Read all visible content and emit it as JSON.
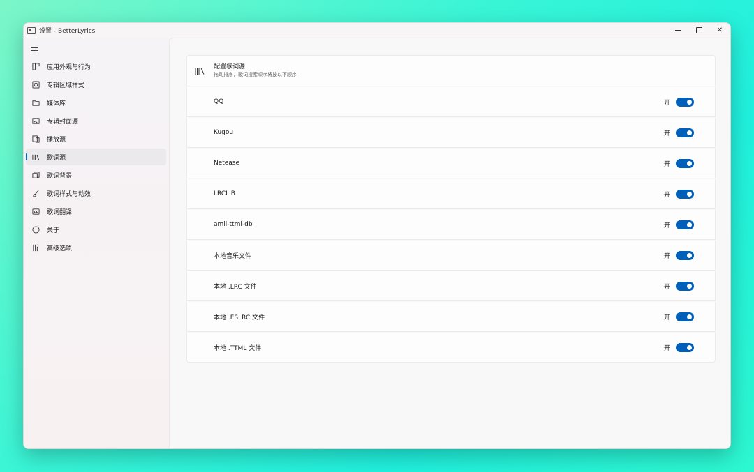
{
  "window": {
    "title": "设置 - BetterLyrics",
    "controls": {
      "minimize": "minimize",
      "maximize": "maximize",
      "close": "✕"
    }
  },
  "sidebar": {
    "items": [
      {
        "label": "应用外观与行为",
        "icon": "layout-icon"
      },
      {
        "label": "专辑区域样式",
        "icon": "album-frame-icon"
      },
      {
        "label": "媒体库",
        "icon": "folder-icon"
      },
      {
        "label": "专辑封面源",
        "icon": "cover-icon"
      },
      {
        "label": "播放源",
        "icon": "player-icon"
      },
      {
        "label": "歌词源",
        "icon": "library-icon",
        "active": true
      },
      {
        "label": "歌词背景",
        "icon": "background-icon"
      },
      {
        "label": "歌词样式与动效",
        "icon": "brush-icon"
      },
      {
        "label": "歌词翻译",
        "icon": "cc-icon"
      },
      {
        "label": "关于",
        "icon": "info-icon"
      },
      {
        "label": "高级选项",
        "icon": "tools-icon"
      }
    ]
  },
  "main": {
    "header": {
      "title": "配置歌词源",
      "subtitle": "拖动排序，歌词搜索顺序将按以下顺序"
    },
    "sources": [
      {
        "name": "QQ",
        "state_label": "开",
        "enabled": true
      },
      {
        "name": "Kugou",
        "state_label": "开",
        "enabled": true
      },
      {
        "name": "Netease",
        "state_label": "开",
        "enabled": true
      },
      {
        "name": "LRCLIB",
        "state_label": "开",
        "enabled": true
      },
      {
        "name": "amll-ttml-db",
        "state_label": "开",
        "enabled": true
      },
      {
        "name": "本地音乐文件",
        "state_label": "开",
        "enabled": true
      },
      {
        "name": "本地 .LRC 文件",
        "state_label": "开",
        "enabled": true
      },
      {
        "name": "本地 .ESLRC 文件",
        "state_label": "开",
        "enabled": true
      },
      {
        "name": "本地 .TTML 文件",
        "state_label": "开",
        "enabled": true
      }
    ]
  },
  "colors": {
    "accent": "#005fb8",
    "background_gradient": "#39f5d6"
  }
}
